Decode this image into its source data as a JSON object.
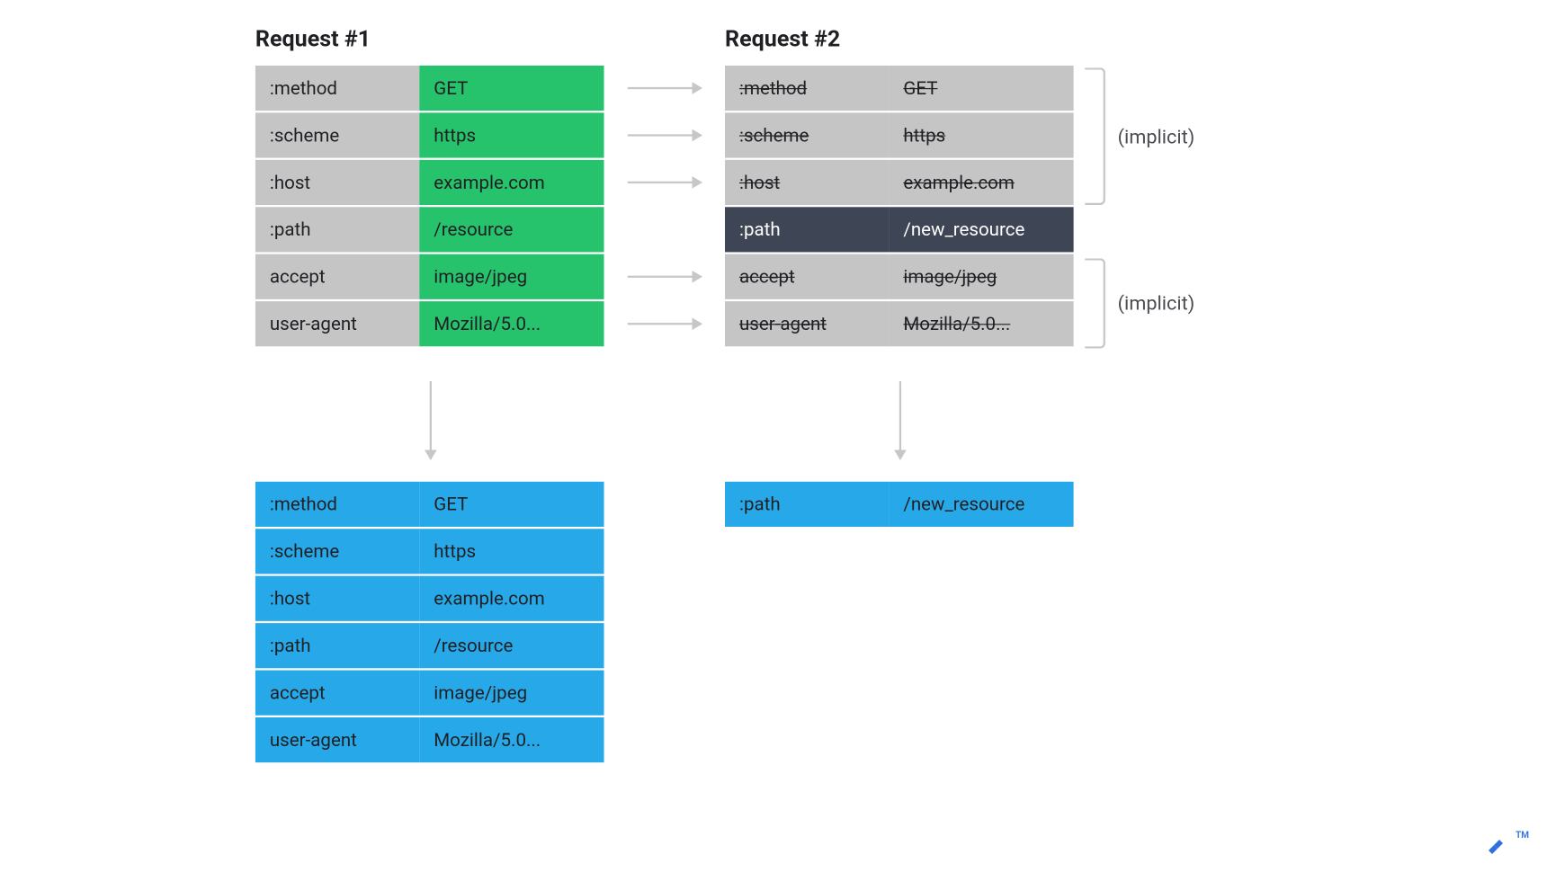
{
  "titles": {
    "req1": "Request #1",
    "req2": "Request #2"
  },
  "implicit_label": "(implicit)",
  "request1": {
    "rows": [
      {
        "key": ":method",
        "value": "GET"
      },
      {
        "key": ":scheme",
        "value": "https"
      },
      {
        "key": ":host",
        "value": "example.com"
      },
      {
        "key": ":path",
        "value": "/resource"
      },
      {
        "key": "accept",
        "value": "image/jpeg"
      },
      {
        "key": "user-agent",
        "value": "Mozilla/5.0..."
      }
    ]
  },
  "request2": {
    "rows": [
      {
        "key": ":method",
        "value": "GET",
        "strike": true
      },
      {
        "key": ":scheme",
        "value": "https",
        "strike": true
      },
      {
        "key": ":host",
        "value": "example.com",
        "strike": true
      },
      {
        "key": ":path",
        "value": "/new_resource",
        "dark": true
      },
      {
        "key": "accept",
        "value": "image/jpeg",
        "strike": true
      },
      {
        "key": "user-agent",
        "value": "Mozilla/5.0...",
        "strike": true
      }
    ]
  },
  "output1": {
    "rows": [
      {
        "key": ":method",
        "value": "GET"
      },
      {
        "key": ":scheme",
        "value": "https"
      },
      {
        "key": ":host",
        "value": "example.com"
      },
      {
        "key": ":path",
        "value": "/resource"
      },
      {
        "key": "accept",
        "value": "image/jpeg"
      },
      {
        "key": "user-agent",
        "value": "Mozilla/5.0..."
      }
    ]
  },
  "output2": {
    "rows": [
      {
        "key": ":path",
        "value": "/new_resource"
      }
    ]
  },
  "logo": {
    "name": "toptal",
    "tm": "TM"
  },
  "colors": {
    "gray": "#c5c5c5",
    "green": "#27c26c",
    "blue": "#27a9e9",
    "dark": "#3e4555",
    "arrow": "#c7c7c7"
  }
}
